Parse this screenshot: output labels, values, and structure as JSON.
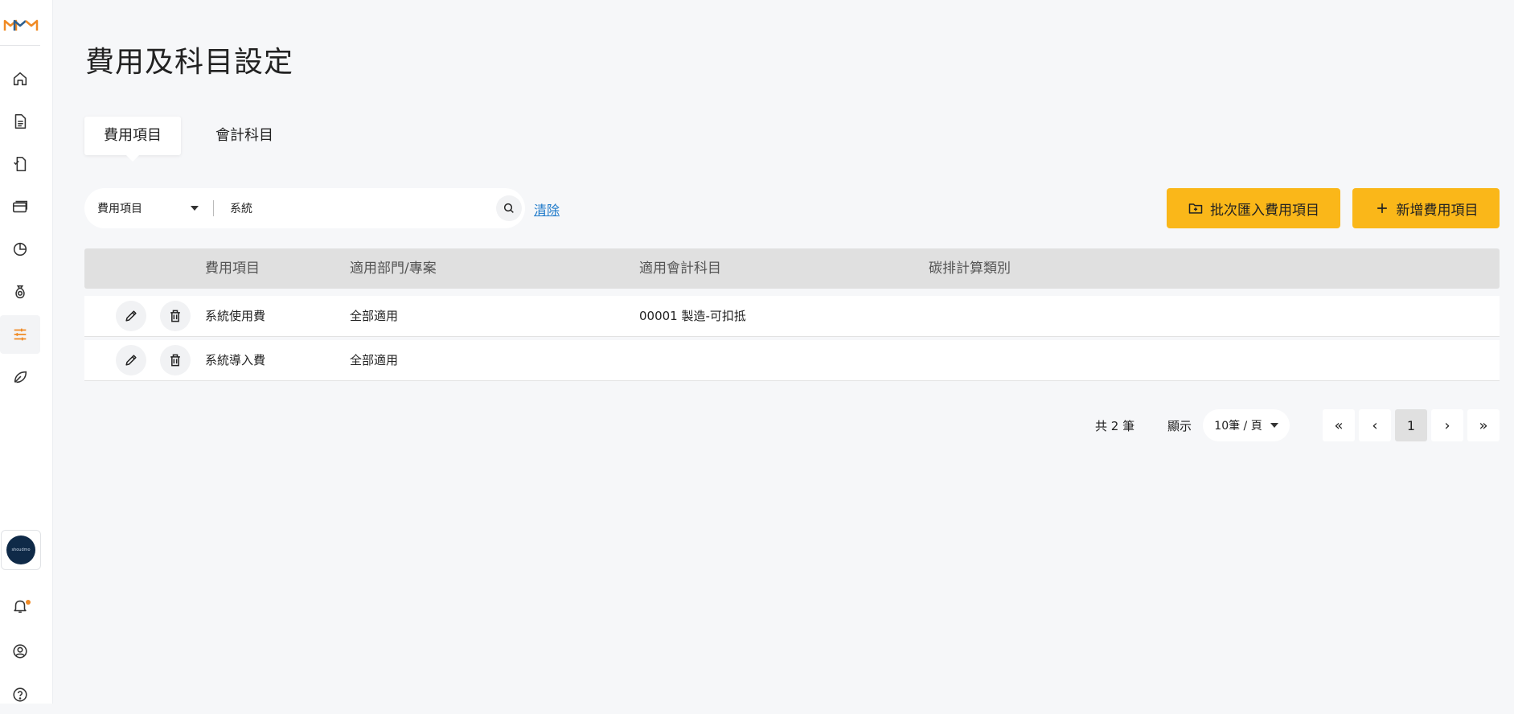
{
  "page": {
    "title": "費用及科目設定"
  },
  "sidebar": {
    "logo": "logo",
    "items": [
      {
        "icon": "home-icon",
        "active": false
      },
      {
        "icon": "document-icon",
        "active": false
      },
      {
        "icon": "approval-document-icon",
        "active": false
      },
      {
        "icon": "card-icon",
        "active": false
      },
      {
        "icon": "pie-chart-icon",
        "active": false
      },
      {
        "icon": "money-bag-icon",
        "active": false
      },
      {
        "icon": "settings-sliders-icon",
        "active": true
      },
      {
        "icon": "leaf-icon",
        "active": false
      }
    ],
    "avatar_text": "shoudmo",
    "bottom": [
      "bell-icon",
      "user-circle-icon",
      "help-icon"
    ]
  },
  "tabs": [
    {
      "label": "費用項目",
      "active": true
    },
    {
      "label": "會計科目",
      "active": false
    }
  ],
  "filter": {
    "field": "費用項目",
    "value": "系統",
    "clear_label": "清除"
  },
  "actions": {
    "import_label": "批次匯入費用項目",
    "add_label": "新增費用項目"
  },
  "table": {
    "columns": [
      "費用項目",
      "適用部門/專案",
      "適用會計科目",
      "碳排計算類別"
    ],
    "rows": [
      {
        "name": "系統使用費",
        "scope": "全部適用",
        "account": "00001 製造-可扣抵",
        "carbon": ""
      },
      {
        "name": "系統導入費",
        "scope": "全部適用",
        "account": "",
        "carbon": ""
      }
    ]
  },
  "pagination": {
    "total": "共 2 筆",
    "show_label": "顯示",
    "page_size": "10筆 / 頁",
    "first": "«",
    "prev": "‹",
    "current": "1",
    "next": "›",
    "last": "»"
  },
  "colors": {
    "accent": "#fab719",
    "logo_orange": "#f08a24",
    "logo_blue": "#2d5f8f",
    "link": "#1d79c9"
  }
}
